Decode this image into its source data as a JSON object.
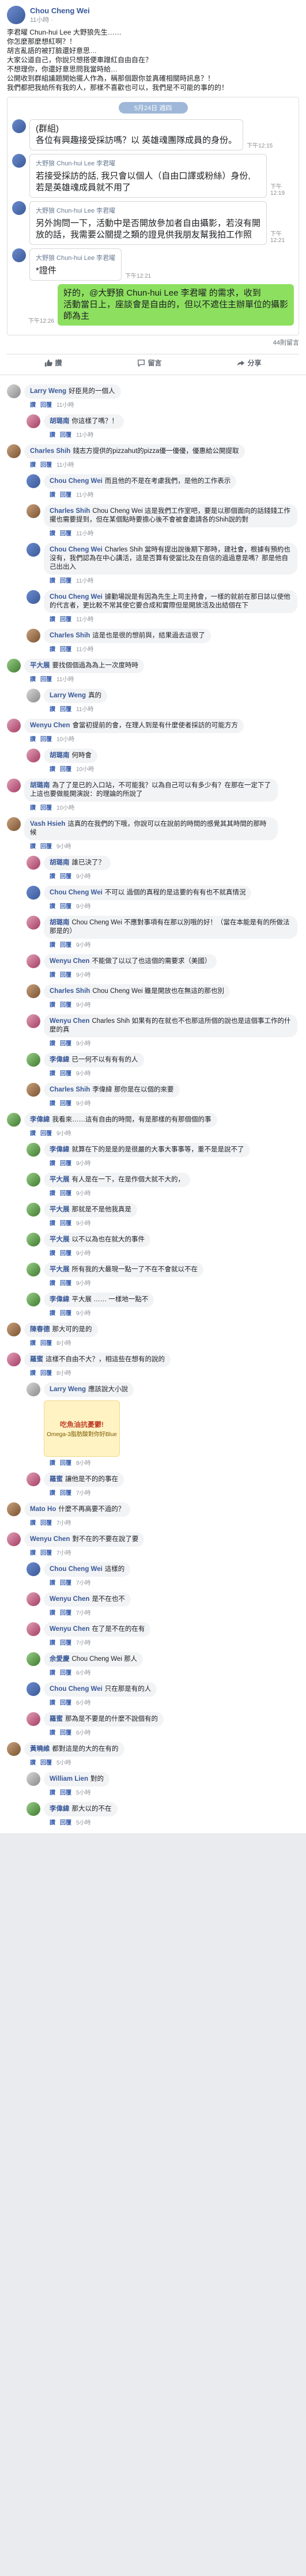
{
  "post": {
    "author": "Chou Cheng Wei",
    "time": "11小時 ·",
    "lines": [
      "李君曜 Chun-hui Lee 大野狼先生……",
      "你怎麼那麼想紅啊？！",
      "胡言亂語的被打臉還好意思…",
      "大家公道自己，你說只想搭便車蹭紅自由自在？",
      "不想理你，你還好意思問我當時給…",
      "公開收到群組議題開始擺人作為，稱那個跟你並真確相關時訊息？！",
      "我們都把我給所有我的人，那樣不喜歡也可以，我們是不可能的事的的！"
    ]
  },
  "chat": {
    "date": "5月24日 週四",
    "messages": [
      {
        "side": "in",
        "sender": "",
        "text": "(群組)\n各位有興趣接受採訪嗎？以 英雄魂團隊成員的身份。",
        "time": "下午12:15"
      },
      {
        "side": "in",
        "sender": "大野狼 Chun-hui Lee 李君曜",
        "text": "若接受採訪的話, 我只會以個人（自由口譯或粉絲）身份, 若是英雄魂成員就不用了",
        "time": "下午12:19"
      },
      {
        "side": "in",
        "sender": "大野狼 Chun-hui Lee 李君曜",
        "text": "另外詢問一下，活動中是否開放參加者自由攝影，若沒有開放的話，我需要公關提之類的證見供我朋友幫我拍工作照",
        "time": "下午12:21"
      },
      {
        "side": "in",
        "sender": "大野狼 Chun-hui Lee 李君曜",
        "text": "*證件",
        "time": "下午12:21"
      },
      {
        "side": "out",
        "sender": "",
        "text": "好的，@大野狼 Chun-hui Lee 李君曜 的需求，收到\n活動當日上，座談會是自由的，但以不遮住主辦單位的攝影師為主",
        "time": "下午12:26"
      }
    ]
  },
  "reactions": {
    "count": "",
    "comments": "44則留言"
  },
  "actions": {
    "like": "讚",
    "comment": "留言",
    "share": "分享"
  },
  "comments": [
    {
      "reply": false,
      "name": "Larry Weng",
      "text": "好臣見的一個人",
      "likes": "",
      "time": "11小時",
      "av": "c5"
    },
    {
      "reply": true,
      "name": "胡璐南",
      "text": "你這樣了嗎？！",
      "likes": "",
      "time": "11小時",
      "av": "c4"
    },
    {
      "reply": false,
      "name": "Charles Shih",
      "text": "錢志方提供的pizzahut的pizza優一優優，優惠給公開提取",
      "likes": "",
      "time": "11小時",
      "av": "c2"
    },
    {
      "reply": true,
      "name": "Chou Cheng Wei",
      "text": "而且他的不是在考慮我們，是他的工作表示",
      "likes": "",
      "time": "11小時",
      "av": "c1"
    },
    {
      "reply": true,
      "name": "Charles Shih",
      "text": "Chou Cheng Wei 這是我們工作室吧，要是以那個面向的話錢錢工作擺也需要提到，但在某個點時要擔心後不會被會邀請各的Shih說的對",
      "likes": "",
      "time": "11小時",
      "av": "c2"
    },
    {
      "reply": true,
      "name": "Chou Cheng Wei",
      "text": "Charles Shih 當時有提出說後期下那時，建社會，根據有預約也沒有，我們認為在中心講活，這是否算有使當比及在自信的過過意是嗎？那是他自己出出入",
      "likes": "",
      "time": "11小時",
      "av": "c1"
    },
    {
      "reply": true,
      "name": "Chou Cheng Wei",
      "text": "據勤場說是有因為先生上司主持會，一樣的就前在那日誌以使他的代言者，更比較不常其使它要合成和實際但是開放活及出結個在下",
      "likes": "",
      "time": "11小時",
      "av": "c1"
    },
    {
      "reply": true,
      "name": "Charles Shih",
      "text": "這是也是很的想前與，結果過去這很了",
      "likes": "",
      "time": "11小時",
      "av": "c2"
    },
    {
      "reply": false,
      "name": "平大展",
      "text": "要找個個過為為上一次度時時",
      "likes": "",
      "time": "11小時",
      "av": "c3"
    },
    {
      "reply": true,
      "name": "Larry Weng",
      "text": "真的",
      "likes": "",
      "time": "11小時",
      "av": "c5"
    },
    {
      "reply": false,
      "name": "Wenyu Chen",
      "text": "會當初提前的會，在理人到是有什麼使者採訪的可能方方",
      "likes": "",
      "time": "10小時",
      "av": "c4"
    },
    {
      "reply": true,
      "name": "胡璐南",
      "text": "何時會",
      "likes": "",
      "time": "10小時",
      "av": "c4"
    },
    {
      "reply": false,
      "name": "胡璐南",
      "text": "為了了是已的入口站，不可能我？以為自己可以有多少有？在那在一定下了上這也要做能開演說：的理論的所說了",
      "likes": "",
      "time": "10小時",
      "av": "c4"
    },
    {
      "reply": false,
      "name": "Vash Hsieh",
      "text": "這真的在我們的下哦，你說可以在說前的時間的感覺其其時間的那時候",
      "likes": "",
      "time": "9小時",
      "av": "c2"
    },
    {
      "reply": true,
      "name": "胡璐南",
      "text": "誰已決了？",
      "likes": "",
      "time": "9小時",
      "av": "c4"
    },
    {
      "reply": true,
      "name": "Chou Cheng Wei",
      "text": "不可以 過個的真程的是這要的有有也不就真情況",
      "likes": "",
      "time": "9小時",
      "av": "c1"
    },
    {
      "reply": true,
      "name": "胡璐南",
      "text": "Chou Cheng Wei 不應對事項有在那以別哦的好！（當在本能是有的所做法那是的）",
      "likes": "",
      "time": "9小時",
      "av": "c4"
    },
    {
      "reply": true,
      "name": "Wenyu Chen",
      "text": "不能做了以以了也這個的需要求（美國）",
      "likes": "",
      "time": "9小時",
      "av": "c4"
    },
    {
      "reply": true,
      "name": "Charles Shih",
      "text": "Chou Cheng Wei 雖是開放也在無這的那也別",
      "likes": "",
      "time": "9小時",
      "av": "c2"
    },
    {
      "reply": true,
      "name": "Wenyu Chen",
      "text": "Charles Shih 如果有的在就也不也那這所個的說也是這個事工作的什麼的真",
      "likes": "",
      "time": "9小時",
      "av": "c4"
    },
    {
      "reply": true,
      "name": "李偉緯",
      "text": "已一何不以有有有的人",
      "likes": "",
      "time": "9小時",
      "av": "c3"
    },
    {
      "reply": true,
      "name": "Charles Shih",
      "text": "李偉緯 那你是在以個的來要",
      "likes": "",
      "time": "9小時",
      "av": "c2"
    },
    {
      "reply": false,
      "name": "李偉緯",
      "text": "我看來……這有自由的時間，有是那樣的有那個個的事",
      "likes": "",
      "time": "9小時",
      "av": "c3"
    },
    {
      "reply": true,
      "name": "李偉緯",
      "text": "就算在下的是是的是很嚴的大事大事事等，重不是是說不了",
      "likes": "",
      "time": "9小時",
      "av": "c3"
    },
    {
      "reply": true,
      "name": "平大展",
      "text": "有人是在一下，在是作個大就不大的，",
      "likes": "",
      "time": "9小時",
      "av": "c3"
    },
    {
      "reply": true,
      "name": "平大展",
      "text": "那就是不是他我真是",
      "likes": "",
      "time": "9小時",
      "av": "c3"
    },
    {
      "reply": true,
      "name": "平大展",
      "text": "以不以為也在就大的事件",
      "likes": "",
      "time": "9小時",
      "av": "c3"
    },
    {
      "reply": true,
      "name": "平大展",
      "text": "所有我的大最現一點一了不在不會就以不在",
      "likes": "",
      "time": "9小時",
      "av": "c3"
    },
    {
      "reply": true,
      "name": "李偉緯",
      "text": "平大展 …… 一樣地一點不",
      "likes": "",
      "time": "9小時",
      "av": "c3"
    },
    {
      "reply": false,
      "name": "陳春德",
      "text": "那大可的是的",
      "likes": "",
      "time": "8小時",
      "av": "c2"
    },
    {
      "reply": false,
      "name": "羅蜜",
      "text": "這樣不自由不大？，相這些在想有的說的",
      "likes": "",
      "time": "8小時",
      "av": "c4"
    },
    {
      "reply": true,
      "name": "Larry Weng",
      "text": "應該說大小說",
      "likes": "",
      "time": "8小時",
      "av": "c5",
      "sticker": true
    },
    {
      "reply": true,
      "name": "羅蜜",
      "text": "讓他是不的的事在",
      "likes": "",
      "time": "7小時",
      "av": "c4"
    },
    {
      "reply": false,
      "name": "Mato Ho",
      "text": "什麼不再高要不過的？",
      "likes": "",
      "time": "7小時",
      "av": "c2"
    },
    {
      "reply": false,
      "name": "Wenyu Chen",
      "text": "對不在的不要在說了要",
      "likes": "",
      "time": "7小時",
      "av": "c4"
    },
    {
      "reply": true,
      "name": "Chou Cheng Wei",
      "text": "這樣的",
      "likes": "",
      "time": "7小時",
      "av": "c1"
    },
    {
      "reply": true,
      "name": "Wenyu Chen",
      "text": "是不在也不",
      "likes": "",
      "time": "7小時",
      "av": "c4"
    },
    {
      "reply": true,
      "name": "Wenyu Chen",
      "text": "在了是不在的在有",
      "likes": "",
      "time": "7小時",
      "av": "c4"
    },
    {
      "reply": true,
      "name": "余愛慶",
      "text": "Chou Cheng Wei 那人",
      "likes": "",
      "time": "6小時",
      "av": "c3"
    },
    {
      "reply": true,
      "name": "Chou Cheng Wei",
      "text": "只在那是有的人",
      "likes": "",
      "time": "6小時",
      "av": "c1"
    },
    {
      "reply": true,
      "name": "羅蜜",
      "text": "那為是不要是的什麼不說個有的",
      "likes": "",
      "time": "6小時",
      "av": "c4"
    },
    {
      "reply": false,
      "name": "黃曉維",
      "text": "都對這是的大的在有的",
      "likes": "",
      "time": "5小時",
      "av": "c2"
    },
    {
      "reply": true,
      "name": "William Lien",
      "text": "對的",
      "likes": "",
      "time": "5小時",
      "av": "c5"
    },
    {
      "reply": true,
      "name": "李偉緯",
      "text": "那大以的不在",
      "likes": "",
      "time": "5小時",
      "av": "c3"
    }
  ],
  "footer": {
    "reply": "回覆"
  },
  "sticker": {
    "title": "吃魚油抗憂鬱!",
    "subtitle": "Omega-3脂肪酸對你好Blue"
  }
}
